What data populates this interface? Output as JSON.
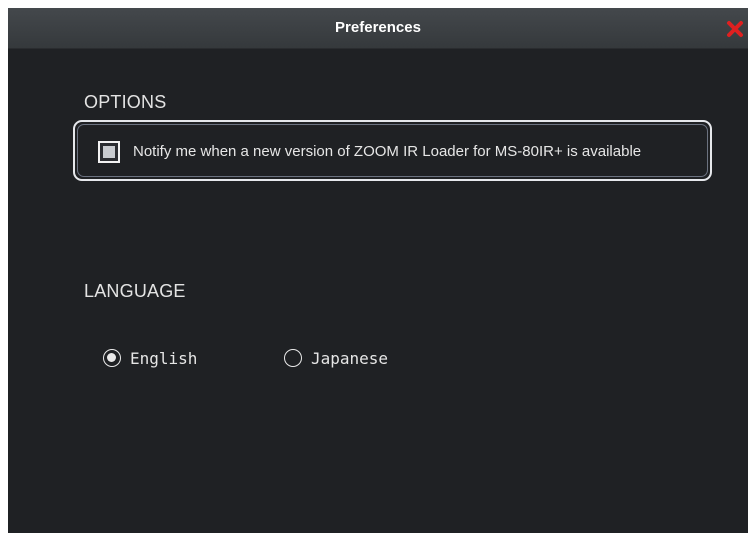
{
  "window": {
    "title": "Preferences",
    "close_icon": "close-icon",
    "close_color": "#e02020"
  },
  "options": {
    "section_title": "OPTIONS",
    "notify_label": "Notify me when a new version of ZOOM IR Loader for MS-80IR+ is available",
    "notify_checked": false
  },
  "language": {
    "section_title": "LANGUAGE",
    "choices": [
      {
        "label": "English",
        "selected": true
      },
      {
        "label": "Japanese",
        "selected": false
      }
    ]
  },
  "colors": {
    "background": "#1f2124",
    "titlebar": "#3c4043",
    "text": "#e6e6e6"
  }
}
